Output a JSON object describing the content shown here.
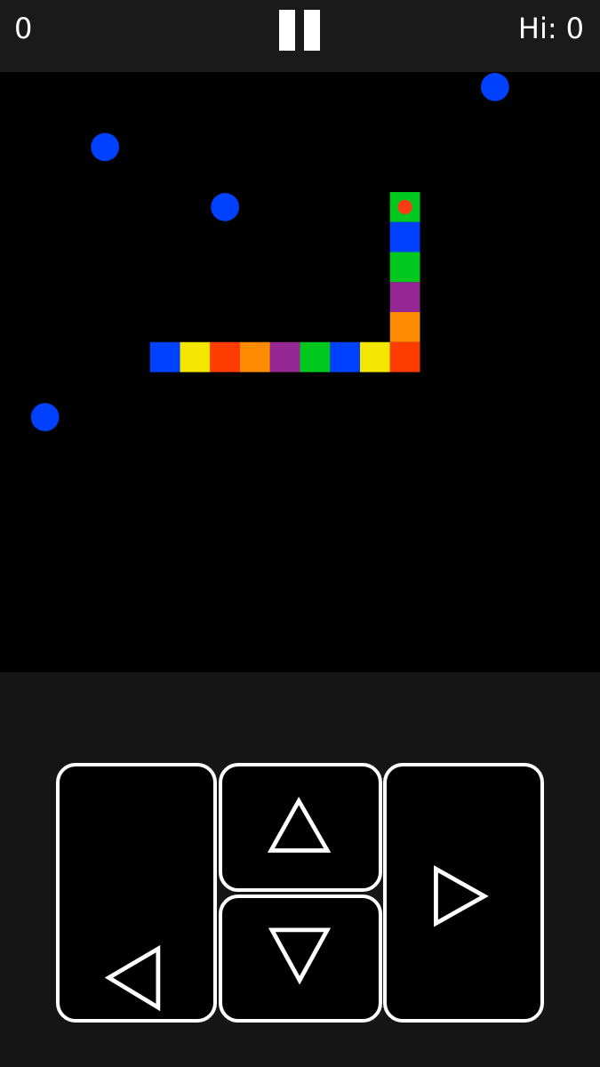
{
  "header": {
    "score": "0",
    "hi_label": "Hi:",
    "hi_score": "0"
  },
  "board": {
    "grid_cells": 20,
    "background": "#000000",
    "snake": {
      "head_marker_color": "#ff3b14",
      "segments": [
        {
          "col": 13,
          "row": 4,
          "color": "#00c81e",
          "head": true
        },
        {
          "col": 13,
          "row": 5,
          "color": "#0040ff"
        },
        {
          "col": 13,
          "row": 6,
          "color": "#00c81e"
        },
        {
          "col": 13,
          "row": 7,
          "color": "#962896"
        },
        {
          "col": 13,
          "row": 8,
          "color": "#ff8c00"
        },
        {
          "col": 13,
          "row": 9,
          "color": "#ff3c00"
        },
        {
          "col": 12,
          "row": 9,
          "color": "#f5e600"
        },
        {
          "col": 11,
          "row": 9,
          "color": "#0040ff"
        },
        {
          "col": 10,
          "row": 9,
          "color": "#00c81e"
        },
        {
          "col": 9,
          "row": 9,
          "color": "#962896"
        },
        {
          "col": 8,
          "row": 9,
          "color": "#ff8c00"
        },
        {
          "col": 7,
          "row": 9,
          "color": "#ff3c00"
        },
        {
          "col": 6,
          "row": 9,
          "color": "#f5e600"
        },
        {
          "col": 5,
          "row": 9,
          "color": "#0040ff"
        }
      ]
    },
    "food": {
      "color": "#0040ff",
      "items": [
        {
          "col": 16,
          "row": 0
        },
        {
          "col": 3,
          "row": 2
        },
        {
          "col": 7,
          "row": 4
        },
        {
          "col": 1,
          "row": 11
        }
      ]
    }
  },
  "controls": {
    "left_icon": "triangle-left-icon",
    "up_icon": "triangle-up-icon",
    "down_icon": "triangle-down-icon",
    "right_icon": "triangle-right-icon"
  },
  "colors": {
    "background": "#161616",
    "topbar": "#1a1a1a",
    "text": "#ffffff",
    "button_border": "#ffffff",
    "button_fill": "#000000"
  }
}
